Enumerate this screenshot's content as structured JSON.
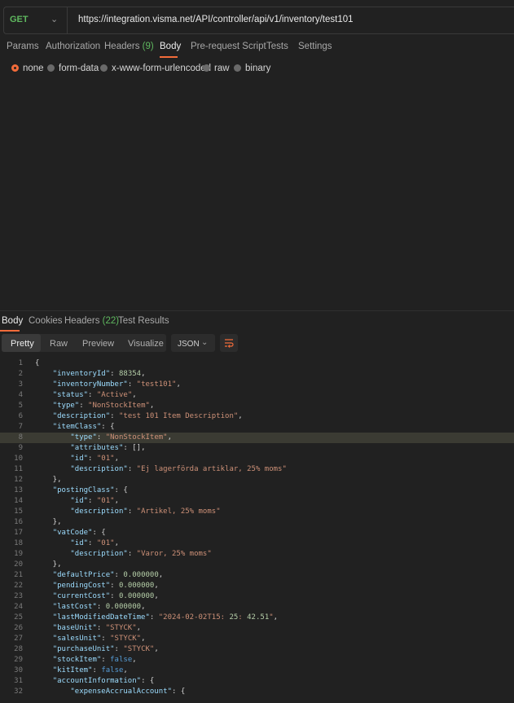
{
  "request": {
    "method": "GET",
    "url": "https://integration.visma.net/API/controller/api/v1/inventory/test101"
  },
  "request_tabs": [
    {
      "label": "Params"
    },
    {
      "label": "Authorization"
    },
    {
      "label": "Headers",
      "count": "(9)"
    },
    {
      "label": "Body"
    },
    {
      "label": "Pre-request Script"
    },
    {
      "label": "Tests"
    },
    {
      "label": "Settings"
    }
  ],
  "body_modes": [
    "none",
    "form-data",
    "x-www-form-urlencoded",
    "raw",
    "binary"
  ],
  "body_mode_selected": "none",
  "response_tabs": [
    {
      "label": "Body"
    },
    {
      "label": "Cookies"
    },
    {
      "label": "Headers",
      "count": "(22)"
    },
    {
      "label": "Test Results"
    }
  ],
  "view_modes": [
    "Pretty",
    "Raw",
    "Preview",
    "Visualize"
  ],
  "format": "JSON",
  "code_lines": [
    "{",
    "    \"inventoryId\": 88354,",
    "    \"inventoryNumber\": \"test101\",",
    "    \"status\": \"Active\",",
    "    \"type\": \"NonStockItem\",",
    "    \"description\": \"test 101 Item Description\",",
    "    \"itemClass\": {",
    "        \"type\": \"NonStockItem\",",
    "        \"attributes\": [],",
    "        \"id\": \"01\",",
    "        \"description\": \"Ej lagerförda artiklar, 25% moms\"",
    "    },",
    "    \"postingClass\": {",
    "        \"id\": \"01\",",
    "        \"description\": \"Artikel, 25% moms\"",
    "    },",
    "    \"vatCode\": {",
    "        \"id\": \"01\",",
    "        \"description\": \"Varor, 25% moms\"",
    "    },",
    "    \"defaultPrice\": 0.000000,",
    "    \"pendingCost\": 0.000000,",
    "    \"currentCost\": 0.000000,",
    "    \"lastCost\": 0.000000,",
    "    \"lastModifiedDateTime\": \"2024-02-02T15:25:42.51\",",
    "    \"baseUnit\": \"STYCK\",",
    "    \"salesUnit\": \"STYCK\",",
    "    \"purchaseUnit\": \"STYCK\",",
    "    \"stockItem\": false,",
    "    \"kitItem\": false,",
    "    \"accountInformation\": {",
    "        \"expenseAccrualAccount\": {"
  ],
  "highlighted_line": 8
}
